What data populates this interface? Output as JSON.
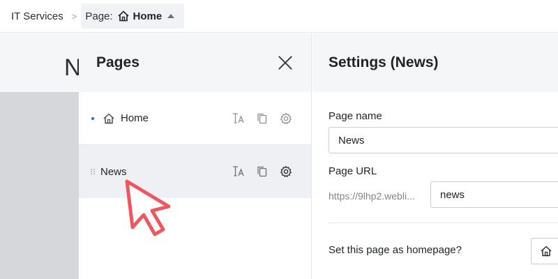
{
  "breadcrumb": {
    "root": "IT Services",
    "separator": ">",
    "prefix": "Page:",
    "current": "Home"
  },
  "background": {
    "heading_fragment": "N"
  },
  "pages_panel": {
    "title": "Pages",
    "items": [
      {
        "label": "Home",
        "is_homepage": true
      },
      {
        "label": "News",
        "is_homepage": false
      }
    ]
  },
  "settings": {
    "title": "Settings (News)",
    "page_name_label": "Page name",
    "page_name_value": "News",
    "page_url_label": "Page URL",
    "url_prefix": "https://9lhp2.webli...",
    "url_value": "news",
    "homepage_question": "Set this page as homepage?"
  },
  "colors": {
    "accent_dot": "#2b6cd4",
    "cursor_outline": "#f0565e",
    "panel_header_bg": "#f5f6f8",
    "selected_row_bg": "#eef0f3"
  },
  "icons": {
    "home": "home-icon",
    "close": "close-icon",
    "rename": "text-font-icon",
    "duplicate": "copy-icon",
    "settings": "gear-icon",
    "drag": "drag-handle-icon",
    "caret": "caret-up-icon"
  }
}
